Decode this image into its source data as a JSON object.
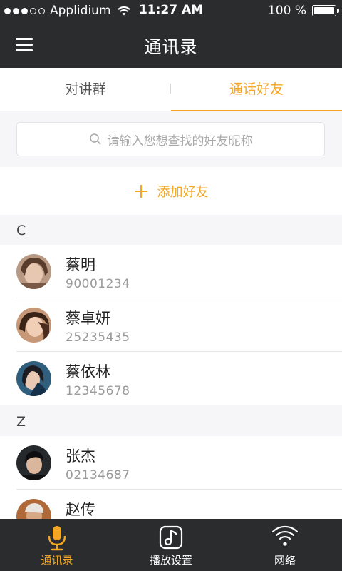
{
  "status_bar": {
    "carrier": "Applidium",
    "time": "11:27 AM",
    "battery": "100 %"
  },
  "navbar": {
    "title": "通讯录",
    "menu_icon": "hamburger-menu-icon"
  },
  "tabs": [
    {
      "label": "对讲群",
      "active": false
    },
    {
      "label": "通话好友",
      "active": true
    }
  ],
  "search": {
    "placeholder": "请输入您想查找的好友昵称",
    "icon": "search-icon"
  },
  "add_friend": {
    "label": "添加好友",
    "icon": "plus-icon"
  },
  "sections": [
    {
      "letter": "C",
      "contacts": [
        {
          "name": "蔡明",
          "number": "90001234"
        },
        {
          "name": "蔡卓妍",
          "number": "25235435"
        },
        {
          "name": "蔡依林",
          "number": "12345678"
        }
      ]
    },
    {
      "letter": "Z",
      "contacts": [
        {
          "name": "张杰",
          "number": "02134687"
        },
        {
          "name": "赵传",
          "number": ""
        }
      ]
    }
  ],
  "bottom_tabs": [
    {
      "label": "通讯录",
      "icon": "microphone-icon",
      "active": true
    },
    {
      "label": "播放设置",
      "icon": "music-note-icon",
      "active": false
    },
    {
      "label": "网络",
      "icon": "wifi-icon",
      "active": false
    }
  ],
  "colors": {
    "accent": "#f5a623",
    "bar_background": "#2b2c2e",
    "page_background": "#f6f6f8"
  }
}
